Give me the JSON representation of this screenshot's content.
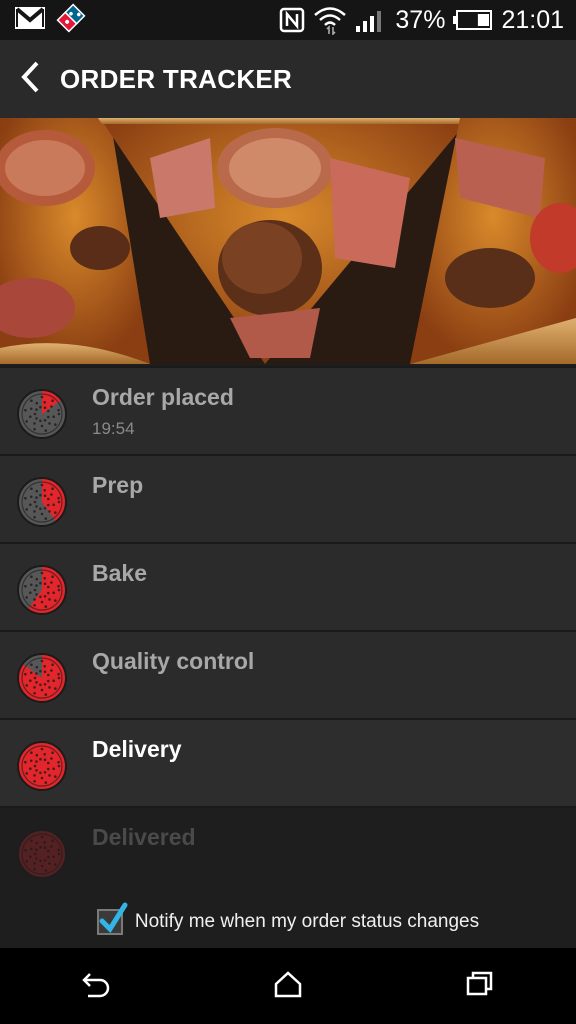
{
  "status_bar": {
    "battery_percent": "37%",
    "time": "21:01",
    "icons": [
      "gmail-icon",
      "dominos-icon",
      "nfc-icon",
      "wifi-icon",
      "signal-icon",
      "battery-icon"
    ],
    "battery_level": 0.37
  },
  "header": {
    "title": "ORDER TRACKER",
    "back_icon": "chevron-left-icon"
  },
  "steps": [
    {
      "label": "Order placed",
      "time": "19:54",
      "state": "done",
      "fill": 0.15
    },
    {
      "label": "Prep",
      "time": "",
      "state": "done",
      "fill": 0.4
    },
    {
      "label": "Bake",
      "time": "",
      "state": "done",
      "fill": 0.6
    },
    {
      "label": "Quality control",
      "time": "",
      "state": "done",
      "fill": 0.85
    },
    {
      "label": "Delivery",
      "time": "",
      "state": "current",
      "fill": 1.0
    },
    {
      "label": "Delivered",
      "time": "",
      "state": "future",
      "fill": 1.0
    }
  ],
  "notify": {
    "label": "Notify me when my order status changes",
    "checked": true
  },
  "nav": {
    "icons": [
      "back-nav-icon",
      "home-icon",
      "recents-icon"
    ]
  },
  "colors": {
    "accent_red": "#e3262b",
    "checkbox_blue": "#33b5e5"
  }
}
